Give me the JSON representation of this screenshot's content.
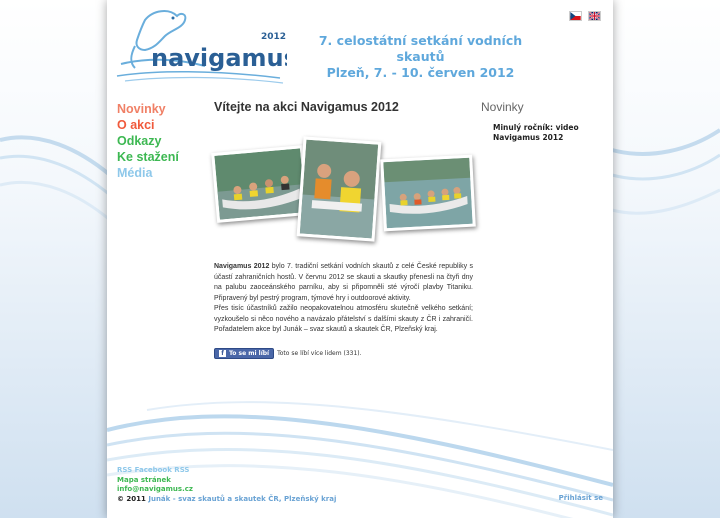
{
  "brand": {
    "logo_year": "2012",
    "logo_name": "navigamus"
  },
  "languages": [
    {
      "code": "cs",
      "icon": "czech-flag-icon"
    },
    {
      "code": "en",
      "icon": "uk-flag-icon"
    }
  ],
  "header": {
    "line1": "7. celostátní setkání vodních skautů",
    "line2": "Plzeň, 7. - 10. červen 2012"
  },
  "nav": [
    {
      "label": "Novinky",
      "color": "#f08066"
    },
    {
      "label": "O akci",
      "color": "#f05a3c"
    },
    {
      "label": "Odkazy",
      "color": "#3db852"
    },
    {
      "label": "Ke stažení",
      "color": "#3db852"
    },
    {
      "label": "Média",
      "color": "#8ec8ea"
    }
  ],
  "main": {
    "title": "Vítejte na akci Navigamus 2012",
    "intro_bold": "Navigamus 2012",
    "intro_rest": " bylo 7. tradiční setkání vodních skautů z celé České republiky s účastí zahraničních hostů. V červnu 2012 se skauti a skautky přenesli na čtyři dny na palubu zaoceánského parníku, aby si připomněli sté výročí plavby Titaniku. Připravený byl pestrý program, týmové hry i outdoorové aktivity.",
    "para2": "Přes tisíc účastníků zažilo neopakovatelnou atmosféru skutečně velkého setkání; vyzkoušelo si něco nového a navázalo přátelství s dalšími skauty z ČR i zahraničí. Pořadatelem akce byl Junák – svaz skautů a skautek ČR, Plzeňský kraj.",
    "fb_button": "To se mi líbí",
    "fb_count": "Toto se líbí více lidem (331)."
  },
  "sidebar": {
    "title": "Novinky",
    "news_line1": "Minulý ročník: video",
    "news_line2": "Navigamus 2012"
  },
  "footer": {
    "rss": "RSS Facebook RSS",
    "sitemap": "Mapa stránek",
    "email": "info@navigamus.cz",
    "copyright_prefix": "© 2011",
    "copyright_link": "Junák - svaz skautů a skautek ČR, Plzeňský kraj",
    "login": "Přihlásit se"
  },
  "colors": {
    "accent_blue": "#5fa8dc",
    "footer_green": "#3db852",
    "footer_blue": "#6aa3d4"
  }
}
